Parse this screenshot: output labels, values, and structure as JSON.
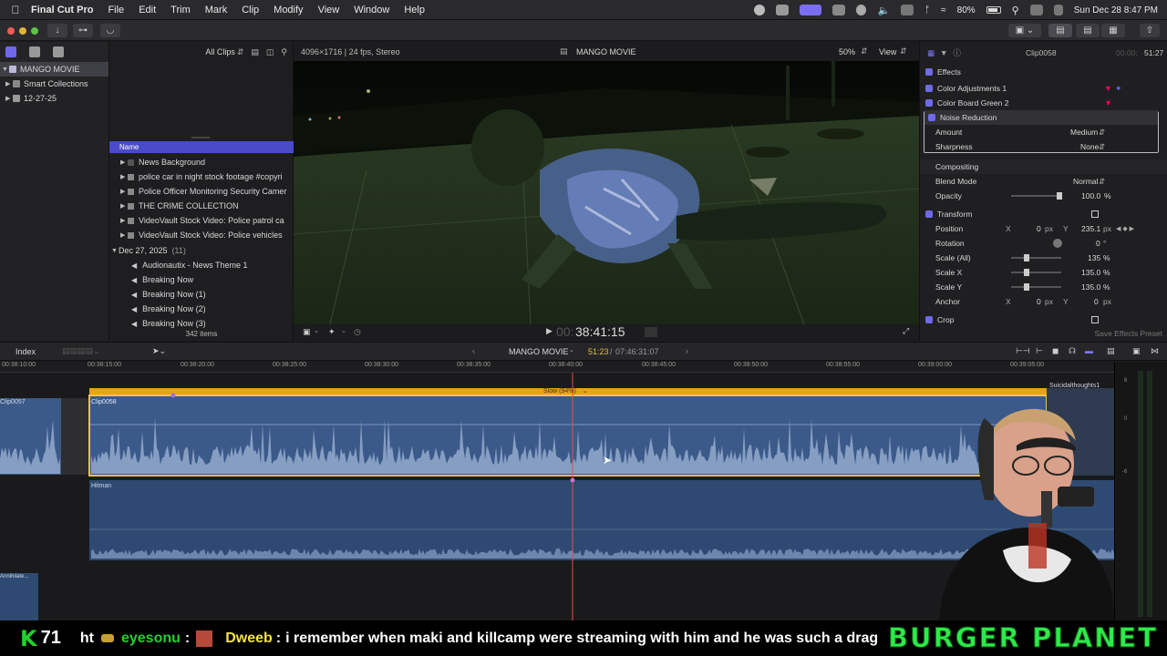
{
  "menubar": {
    "app": "Final Cut Pro",
    "items": [
      "File",
      "Edit",
      "Trim",
      "Mark",
      "Clip",
      "Modify",
      "View",
      "Window",
      "Help"
    ],
    "battery": "80%",
    "datetime": "Sun Dec 28  8:47 PM"
  },
  "library": {
    "items": [
      {
        "label": "MANGO MOVIE",
        "selected": true
      },
      {
        "label": "Smart Collections"
      },
      {
        "label": "12-27-25"
      }
    ]
  },
  "browser": {
    "filter": "All Clips",
    "column_name": "Name",
    "items": [
      {
        "label": "News Background",
        "type": "folder"
      },
      {
        "label": "police  car in night stock footage #copyri",
        "type": "folder"
      },
      {
        "label": "Police Officer Monitoring Security Camer",
        "type": "folder"
      },
      {
        "label": "THE CRIME COLLECTION",
        "type": "folder"
      },
      {
        "label": "VideoVault Stock Video:   Police patrol ca",
        "type": "folder"
      },
      {
        "label": "VideoVault Stock Video:   Police vehicles",
        "type": "folder"
      }
    ],
    "group": {
      "label": "Dec 27, 2025",
      "count": "(11)"
    },
    "audio_items": [
      "Audionautix - News Theme 1",
      "Breaking Now",
      "Breaking Now (1)",
      "Breaking Now (2)",
      "Breaking Now (3)"
    ],
    "footer": "342 items"
  },
  "viewer": {
    "format": "4096×1716 | 24 fps, Stereo",
    "title": "MANGO MOVIE",
    "zoom": "50%",
    "view": "View",
    "timecode_dim": "00:",
    "timecode": "38:41:15"
  },
  "inspector": {
    "clip": "Clip0058",
    "duration": "51:27",
    "duration_dim": "00:00:",
    "effects_header": "Effects",
    "effects": [
      "Color Adjustments 1",
      "Color Board Green 2",
      "Noise Reduction"
    ],
    "noise": [
      {
        "label": "Amount",
        "value": "Medium"
      },
      {
        "label": "Sharpness",
        "value": "None"
      }
    ],
    "compositing": {
      "header": "Compositing",
      "blend_label": "Blend Mode",
      "blend_value": "Normal",
      "opacity_label": "Opacity",
      "opacity_value": "100.0",
      "opacity_unit": "%"
    },
    "transform": {
      "header": "Transform",
      "rows": [
        {
          "label": "Position",
          "x": "0",
          "y": "235.1",
          "unit": "px"
        },
        {
          "label": "Rotation",
          "value": "0",
          "unit": "°"
        },
        {
          "label": "Scale (All)",
          "value": "135",
          "unit": "%"
        },
        {
          "label": "Scale X",
          "value": "135.0",
          "unit": "%"
        },
        {
          "label": "Scale Y",
          "value": "135.0",
          "unit": "%"
        },
        {
          "label": "Anchor",
          "x": "0",
          "y": "0",
          "unit": "px"
        }
      ],
      "x_label": "X",
      "y_label": "Y"
    },
    "crop": "Crop",
    "save_preset": "Save Effects Preset"
  },
  "timeline": {
    "index": "Index",
    "project": "MANGO MOVIE",
    "position": "51:23",
    "total": "07:46:31:07",
    "ruler": [
      "00:38:10:00",
      "00:38:15:00",
      "00:38:20:00",
      "00:38:25:00",
      "00:38:30:00",
      "00:38:35:00",
      "00:38:40:00",
      "00:38:45:00",
      "00:38:50:00",
      "00:38:55:00",
      "00:39:00:00",
      "00:39:05:00"
    ],
    "clips": {
      "prev": "Clip0057",
      "main": "Clip0058",
      "retime": "Slow (94%)",
      "next": "Suicidalthoughts1",
      "music": "Hitman",
      "bottom": "Annihilate..."
    }
  },
  "meter_labels": [
    "6",
    "0",
    "-6"
  ],
  "chat": {
    "count": "71",
    "prefix": "ht",
    "user": "eyesonu",
    "user_sep": ":",
    "user2": "Dweeb",
    "message": "i remember when maki and killcamp were streaming with him and he was such a drag",
    "brand": "BURGER PLANET"
  },
  "colors": {
    "accent": "#6e6ae8",
    "clip": "#3b5a8a",
    "retime": "#e8a21c",
    "chat_green": "#22d12b",
    "brand": "#2ee94a",
    "playhead": "#f04848"
  }
}
